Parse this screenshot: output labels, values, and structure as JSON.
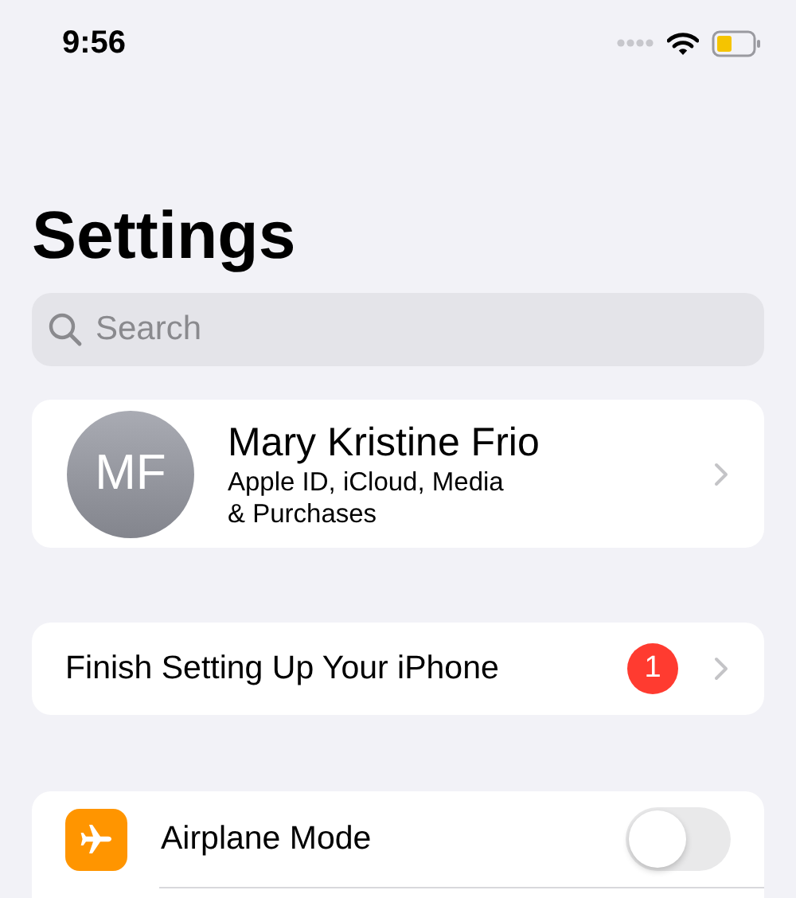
{
  "status_bar": {
    "time": "9:56"
  },
  "title": "Settings",
  "search": {
    "placeholder": "Search"
  },
  "profile": {
    "initials": "MF",
    "name": "Mary Kristine Frio",
    "subtitle": "Apple ID, iCloud, Media & Purchases"
  },
  "setup": {
    "label": "Finish Setting Up Your iPhone",
    "badge": "1"
  },
  "settings": [
    {
      "kind": "toggle",
      "label": "Airplane Mode",
      "on": false
    }
  ]
}
